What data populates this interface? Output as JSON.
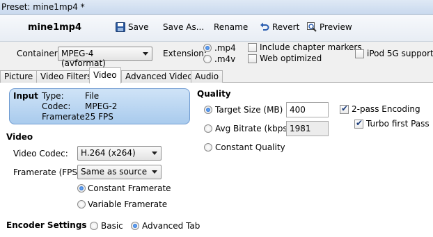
{
  "titlebar": {
    "text": "Preset: mine1mp4 *"
  },
  "toolbar": {
    "preset_name": "mine1mp4",
    "save": "Save",
    "save_as": "Save As...",
    "rename": "Rename",
    "revert": "Revert",
    "preview": "Preview"
  },
  "options": {
    "container_label": "Container:",
    "container_value": "MPEG-4 (avformat)",
    "extension_label": "Extension:",
    "ext_mp4": ".mp4",
    "ext_m4v": ".m4v",
    "include_chapter": "Include chapter markers",
    "web_optimized": "Web optimized",
    "ipod": "iPod 5G support"
  },
  "tabs": [
    "Picture",
    "Video Filters",
    "Video",
    "Advanced Video",
    "Audio"
  ],
  "input": {
    "title": "Input",
    "type_label": "Type:",
    "type_value": "File",
    "codec_label": "Codec:",
    "codec_value": "MPEG-2",
    "framerate_label": "Framerate:",
    "framerate_value": "25 FPS"
  },
  "video": {
    "header": "Video",
    "codec_label": "Video Codec:",
    "codec_value": "H.264 (x264)",
    "fps_label": "Framerate (FPS):",
    "fps_value": "Same as source",
    "constant": "Constant Framerate",
    "variable": "Variable Framerate"
  },
  "quality": {
    "header": "Quality",
    "target_size": "Target Size (MB)",
    "target_value": "400",
    "avg_bitrate": "Avg Bitrate (kbps)",
    "avg_value": "1981",
    "constant_quality": "Constant Quality",
    "two_pass": "2-pass Encoding",
    "turbo": "Turbo first Pass"
  },
  "encoder": {
    "header": "Encoder Settings",
    "basic": "Basic",
    "advanced": "Advanced Tab"
  }
}
